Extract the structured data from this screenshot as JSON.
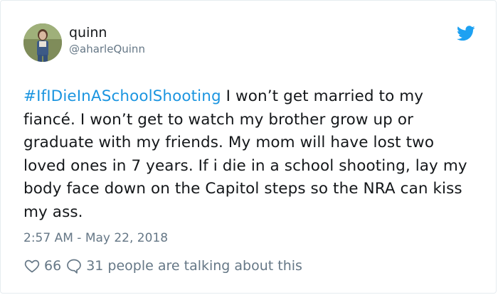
{
  "author": {
    "name": "quinn",
    "handle": "@aharleQuinn"
  },
  "tweet": {
    "hashtag": "#IfIDieInASchoolShooting",
    "body": " I won’t get married to my fiancé. I won’t get to watch my brother grow up or graduate with my friends. My mom will have lost two loved ones in 7 years. If i die in a school shooting, lay my body face down on the Capitol steps so the NRA can kiss my ass.",
    "timestamp": "2:57 AM - May 22, 2018"
  },
  "stats": {
    "likes": "66",
    "talking": "31 people are talking about this"
  },
  "icons": {
    "brand": "twitter-bird-icon",
    "like": "heart-icon",
    "reply": "speech-bubble-icon"
  },
  "colors": {
    "link": "#1b95e0",
    "text": "#14171a",
    "muted": "#657786",
    "twitter_blue": "#1da1f2"
  }
}
